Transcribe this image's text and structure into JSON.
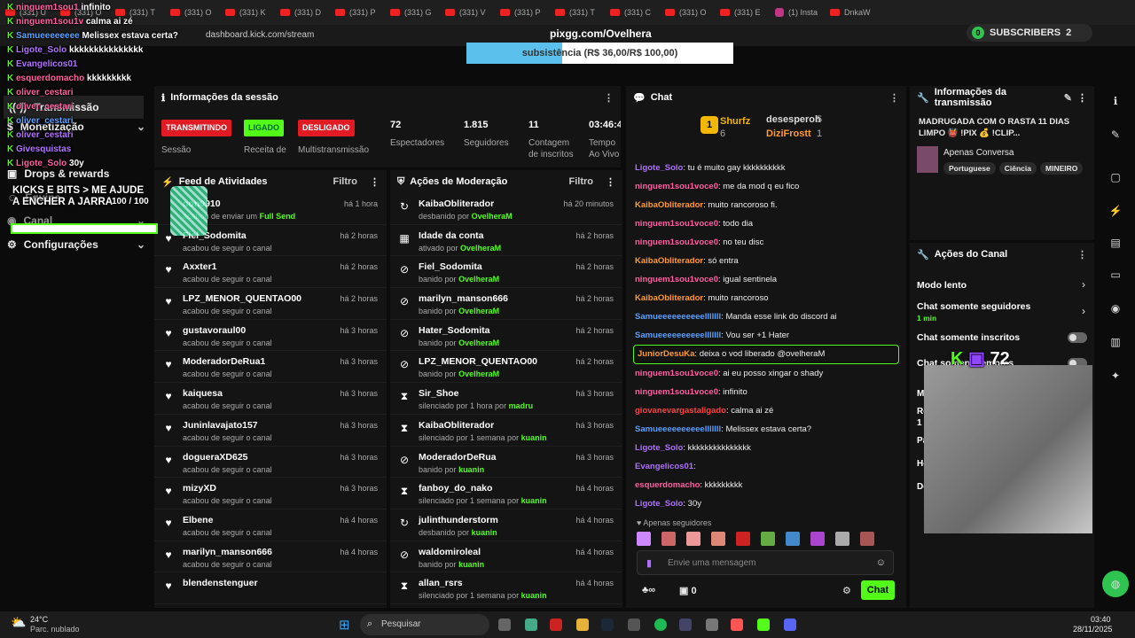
{
  "browser": {
    "tabs": [
      "(331) U",
      "(331) O",
      "(331) T",
      "(331) O",
      "(331) K",
      "(331) D",
      "(331) P",
      "(331) G",
      "(331) V",
      "(331) P",
      "(331) T",
      "(331) C",
      "(331) O",
      "(331) E",
      "(1) Insta",
      "DnkaW"
    ],
    "url": "dashboard.kick.com/stream",
    "page_title": "pixgg.com/Ovelhera"
  },
  "subs": {
    "label": "SUBSCRIBERS",
    "count": "2",
    "sub_count": "0"
  },
  "goal": {
    "label": "subsistência (R$ 36,00/R$ 100,00)",
    "progress": 0.36
  },
  "overlay": {
    "chat": [
      {
        "user": "ninguem1sou1",
        "msg": "infinito"
      },
      {
        "user": "ninguem1sou1v",
        "msg": "calma ai zé"
      },
      {
        "user": "Samueeeeeeee",
        "msg": "Melissex estava certa?"
      },
      {
        "user": "Ligote_Solo",
        "msg": "kkkkkkkkkkkkkkk"
      },
      {
        "user": "Evangelicos01",
        "msg": ""
      },
      {
        "user": "esquerdomacho",
        "msg": "kkkkkkkkk"
      },
      {
        "user": "oliver_cestari",
        "msg": ""
      },
      {
        "user": "oliver_cestari",
        "msg": ""
      },
      {
        "user": "oliver_cestari",
        "msg": ""
      },
      {
        "user": "oliver_cestari",
        "msg": ""
      },
      {
        "user": "Givesquistas",
        "msg": ""
      },
      {
        "user": "Ligote_Solo",
        "msg": "30y"
      }
    ],
    "kicks_title": "KICKS E BITS > ME AJUDE A ENCHER A JARRA",
    "kicks_val": "100",
    "kicks_max": "100",
    "counter": "72"
  },
  "sidebar": {
    "items": [
      {
        "label": "Transmissão"
      },
      {
        "label": "Monetização"
      },
      {
        "label": "Drops & rewards"
      },
      {
        "label": "Equipe"
      },
      {
        "label": "Canal"
      },
      {
        "label": "Configurações"
      }
    ]
  },
  "session": {
    "title": "Informações da sessão",
    "badges": [
      {
        "label": "TRANSMITINDO",
        "color": "#e01b24",
        "caption": "Sessão"
      },
      {
        "label": "LIGADO",
        "color": "#53fc18",
        "caption": "Receita de"
      },
      {
        "label": "DESLIGADO",
        "color": "#e01b24",
        "caption": "Multistransmissão"
      }
    ],
    "stats": [
      {
        "value": "72",
        "label": "Espectadores"
      },
      {
        "value": "1.815",
        "label": "Seguidores"
      },
      {
        "value": "11",
        "label": "Contagem de inscritos"
      },
      {
        "value": "03:46:42",
        "label": "Tempo Ao Vivo"
      }
    ]
  },
  "feed": {
    "title": "Feed de Atividades",
    "filter": "Filtro",
    "items": [
      {
        "name": "oon0910",
        "desc": "acabou de enviar um",
        "gift": "Full Send",
        "time": "há 1 hora"
      },
      {
        "name": "Fiel_Sodomita",
        "desc": "acabou de seguir o canal",
        "time": "há 2 horas"
      },
      {
        "name": "Axxter1",
        "desc": "acabou de seguir o canal",
        "time": "há 2 horas"
      },
      {
        "name": "LPZ_MENOR_QUENTAO00",
        "desc": "acabou de seguir o canal",
        "time": "há 2 horas"
      },
      {
        "name": "gustavoraul00",
        "desc": "acabou de seguir o canal",
        "time": "há 3 horas"
      },
      {
        "name": "ModeradorDeRua1",
        "desc": "acabou de seguir o canal",
        "time": "há 3 horas"
      },
      {
        "name": "kaiquesa",
        "desc": "acabou de seguir o canal",
        "time": "há 3 horas"
      },
      {
        "name": "Juninlavajato157",
        "desc": "acabou de seguir o canal",
        "time": "há 3 horas"
      },
      {
        "name": "dogueraXD625",
        "desc": "acabou de seguir o canal",
        "time": "há 3 horas"
      },
      {
        "name": "mizyXD",
        "desc": "acabou de seguir o canal",
        "time": "há 3 horas"
      },
      {
        "name": "Elbene",
        "desc": "acabou de seguir o canal",
        "time": "há 4 horas"
      },
      {
        "name": "marilyn_manson666",
        "desc": "acabou de seguir o canal",
        "time": "há 4 horas"
      },
      {
        "name": "blendenstenguer",
        "desc": "",
        "time": ""
      }
    ]
  },
  "mod": {
    "title": "Ações de Moderação",
    "filter": "Filtro",
    "items": [
      {
        "icon": "↻",
        "name": "KaibaObliterador",
        "desc": "desbanido por",
        "by": "OvelheraM",
        "time": "há 20 minutos"
      },
      {
        "icon": "▦",
        "name": "Idade da conta",
        "desc": "ativado por",
        "by": "OvelheraM",
        "time": "há 2 horas"
      },
      {
        "icon": "⊘",
        "name": "Fiel_Sodomita",
        "desc": "banido por",
        "by": "OvelheraM",
        "time": "há 2 horas"
      },
      {
        "icon": "⊘",
        "name": "marilyn_manson666",
        "desc": "banido por",
        "by": "OvelheraM",
        "time": "há 2 horas"
      },
      {
        "icon": "⊘",
        "name": "Hater_Sodomita",
        "desc": "banido por",
        "by": "OvelheraM",
        "time": "há 2 horas"
      },
      {
        "icon": "⊘",
        "name": "LPZ_MENOR_QUENTAO00",
        "desc": "banido por",
        "by": "OvelheraM",
        "time": "há 2 horas"
      },
      {
        "icon": "⧗",
        "name": "Sir_Shoe",
        "desc": "silenciado por 1 hora por",
        "by": "madru",
        "time": "há 3 horas"
      },
      {
        "icon": "⧗",
        "name": "KaibaObliterador",
        "desc": "silenciado por 1 semana por",
        "by": "kuanin",
        "time": "há 3 horas"
      },
      {
        "icon": "⊘",
        "name": "ModeradorDeRua",
        "desc": "banido por",
        "by": "kuanin",
        "time": "há 3 horas"
      },
      {
        "icon": "⧗",
        "name": "fanboy_do_nako",
        "desc": "silenciado por 1 semana por",
        "by": "kuanin",
        "time": "há 4 horas"
      },
      {
        "icon": "↻",
        "name": "julinthunderstorm",
        "desc": "desbanido por",
        "by": "kuanin",
        "time": "há 4 horas"
      },
      {
        "icon": "⊘",
        "name": "waldomiroleal",
        "desc": "banido por",
        "by": "kuanin",
        "time": "há 4 horas"
      },
      {
        "icon": "⧗",
        "name": "allan_rsrs",
        "desc": "silenciado por 1 semana por",
        "by": "kuanin",
        "time": "há 4 horas"
      }
    ]
  },
  "chat": {
    "title": "Chat",
    "top": [
      {
        "name": "Shurfz",
        "num": "6"
      },
      {
        "name": "desesperoh",
        "num": "5"
      },
      {
        "name": "DiziFrostt",
        "num": "1"
      }
    ],
    "messages": [
      {
        "user": "Ligote_Solo",
        "color": "#b070ff",
        "msg": "tu é muito gay kkkkkkkkkk"
      },
      {
        "user": "ninguem1sou1voce0",
        "color": "#ff5fa0",
        "msg": "me da mod q eu fico"
      },
      {
        "user": "KaibaObliterador",
        "color": "#ff9a2e",
        "msg": "muito rancoroso fi."
      },
      {
        "user": "ninguem1sou1voce0",
        "color": "#ff5fa0",
        "msg": "todo dia"
      },
      {
        "user": "ninguem1sou1voce0",
        "color": "#ff5fa0",
        "msg": "no teu disc"
      },
      {
        "user": "KaibaObliterador",
        "color": "#ff9a2e",
        "msg": "só entra"
      },
      {
        "user": "ninguem1sou1voce0",
        "color": "#ff5fa0",
        "msg": "igual sentinela"
      },
      {
        "user": "KaibaObliterador",
        "color": "#ff9a2e",
        "msg": "muito rancoroso"
      },
      {
        "user": "Samueeeeeeeeeelllllll",
        "color": "#5aa0ff",
        "msg": "Manda esse link do discord ai"
      },
      {
        "user": "Samueeeeeeeeeelllllll",
        "color": "#5aa0ff",
        "msg": "Vou ser +1 Hater"
      },
      {
        "user": "JuniorDesuKa",
        "color": "#ff9a2e",
        "msg": "deixa o vod liberado @ovelheraM",
        "highlight": true
      },
      {
        "user": "ninguem1sou1voce0",
        "color": "#ff5fa0",
        "msg": "ai eu posso xingar o shady"
      },
      {
        "user": "ninguem1sou1voce0",
        "color": "#ff5fa0",
        "msg": "infinito"
      },
      {
        "user": "giovanevargastaligado",
        "color": "#ff4040",
        "msg": "calma ai zé"
      },
      {
        "user": "Samueeeeeeeeeelllllll",
        "color": "#5aa0ff",
        "msg": "Melissex estava certa?"
      },
      {
        "user": "Ligote_Solo",
        "color": "#b070ff",
        "msg": "kkkkkkkkkkkkkkk"
      },
      {
        "user": "Evangelicos01",
        "color": "#b070ff",
        "msg": ""
      },
      {
        "user": "esquerdomacho",
        "color": "#ff5fa0",
        "msg": "kkkkkkkkk"
      },
      {
        "user": "Ligote_Solo",
        "color": "#b070ff",
        "msg": "30y"
      }
    ],
    "followers_only": "Apenas seguidores",
    "placeholder": "Envie uma mensagem",
    "count": "0",
    "send": "Chat"
  },
  "stream_info": {
    "title": "Informações da transmissão",
    "stream_title": "MADRUGADA COM O RASTA 11 DIAS LIMPO 👹 !PIX 💰 !CLIP...",
    "category": "Apenas Conversa",
    "tags": [
      "Portuguese",
      "Ciência",
      "MINEIRO"
    ]
  },
  "channel_actions": {
    "title": "Ações do Canal",
    "items": [
      {
        "label": "Modo lento",
        "sub": ""
      },
      {
        "label": "Chat somente seguidores",
        "sub": "1 min"
      },
      {
        "label": "Chat somente inscritos",
        "sub": ""
      },
      {
        "label": "Chat somente emotes",
        "sub": ""
      }
    ],
    "partial": [
      "Mo",
      "Re",
      "1 d",
      "Pa",
      "Ho",
      "De"
    ]
  },
  "taskbar": {
    "weather_temp": "24°C",
    "weather_desc": "Parc. nublado",
    "search": "Pesquisar",
    "time": "03:40",
    "date": "28/11/2025"
  }
}
